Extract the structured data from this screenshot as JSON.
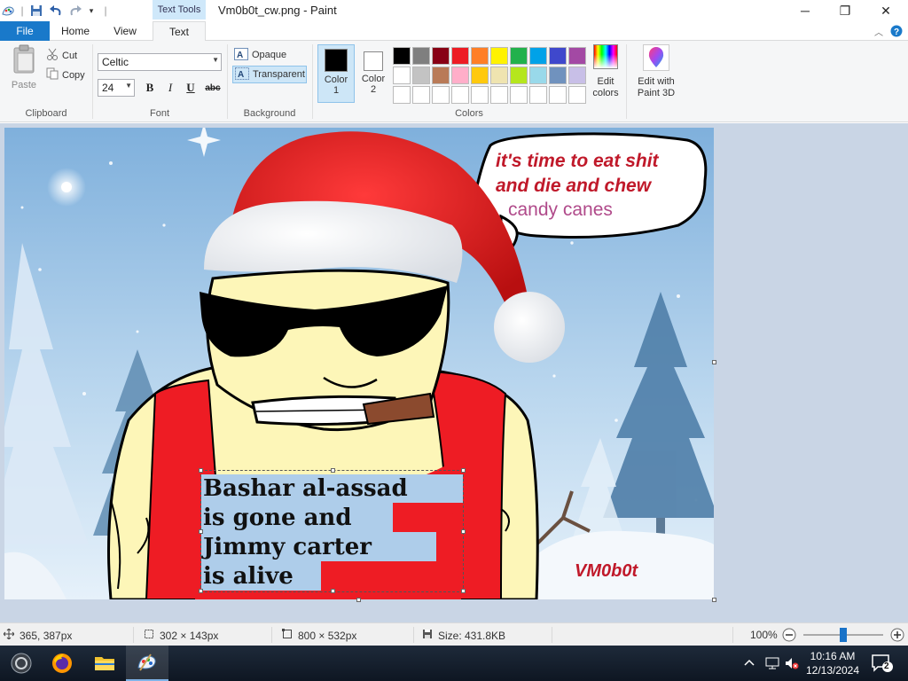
{
  "window": {
    "title": "Vm0b0t_cw.png - Paint",
    "context_tab": "Text Tools",
    "minimize": "─",
    "maximize": "❐",
    "close": "✕"
  },
  "tabs": {
    "file": "File",
    "home": "Home",
    "view": "View",
    "text": "Text"
  },
  "clipboard": {
    "paste": "Paste",
    "cut": "Cut",
    "copy": "Copy",
    "group": "Clipboard"
  },
  "font": {
    "family": "Celtic",
    "size": "24",
    "bold": "B",
    "italic": "I",
    "underline": "U",
    "strike": "abc",
    "group": "Font"
  },
  "background": {
    "opaque": "Opaque",
    "transparent": "Transparent",
    "group": "Background"
  },
  "colors": {
    "color1_label": "Color",
    "color1_num": "1",
    "color2_label": "Color",
    "color2_num": "2",
    "edit_colors_l1": "Edit",
    "edit_colors_l2": "colors",
    "paint3d_l1": "Edit with",
    "paint3d_l2": "Paint 3D",
    "group": "Colors",
    "color1": "#000000",
    "color2": "#ffffff",
    "palette": [
      "#000000",
      "#7f7f7f",
      "#880015",
      "#ed1c24",
      "#ff7f27",
      "#fff200",
      "#22b14c",
      "#00a2e8",
      "#3f48cc",
      "#a349a4",
      "#ffffff",
      "#c3c3c3",
      "#b97a57",
      "#ffaec9",
      "#ffc90e",
      "#efe4b0",
      "#b5e61d",
      "#99d9ea",
      "#7092be",
      "#c8bfe7",
      "#ffffff",
      "#ffffff",
      "#ffffff",
      "#ffffff",
      "#ffffff",
      "#ffffff",
      "#ffffff",
      "#ffffff",
      "#ffffff",
      "#ffffff"
    ]
  },
  "image": {
    "bubble_line1": "it's time to eat shit",
    "bubble_line2": "and die and chew",
    "bubble_line3": "candy canes",
    "caption_line1": "Bashar al-assad",
    "caption_line2": "is gone and",
    "caption_line3": "Jimmy carter",
    "caption_line4": "is alive",
    "signature": "VM0b0t"
  },
  "status": {
    "cursor_pos": "365, 387px",
    "selection_size": "302 × 143px",
    "image_size": "800 × 532px",
    "file_size": "Size: 431.8KB",
    "zoom": "100%",
    "zoom_level_fraction": 0.5
  },
  "taskbar": {
    "time": "10:16 AM",
    "date": "12/13/2024",
    "notifications": "2"
  }
}
